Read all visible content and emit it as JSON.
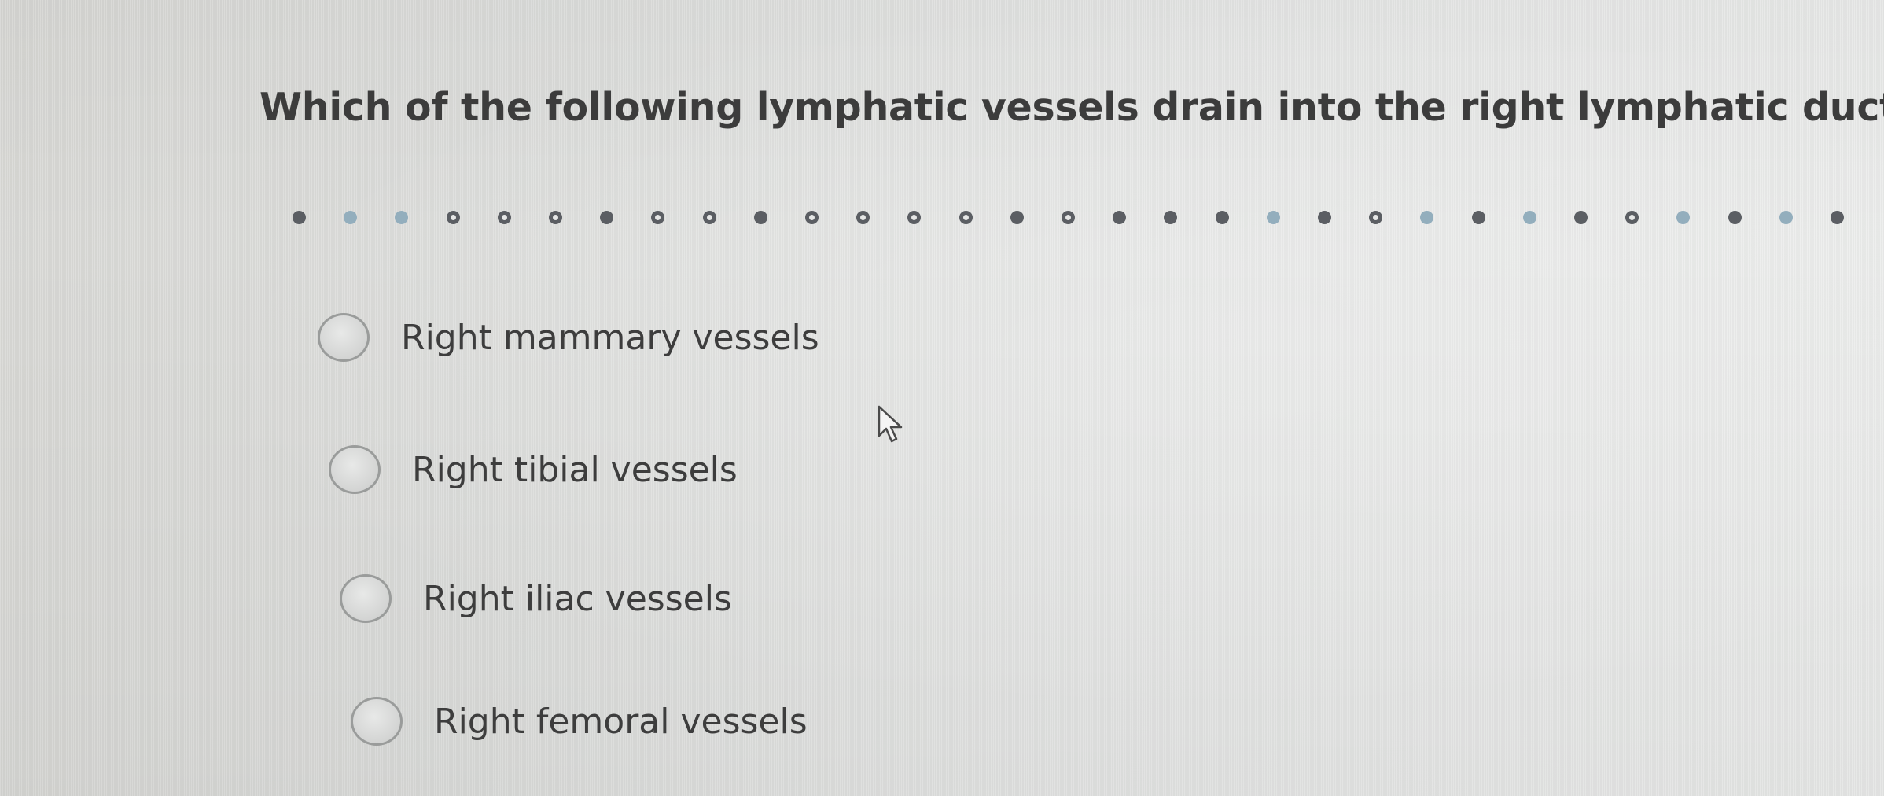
{
  "question": {
    "text": "Which of the following lymphatic vessels drain into the right lymphatic duct?"
  },
  "progress_dots": [
    "filled",
    "light",
    "light",
    "ring",
    "ring",
    "ring",
    "filled",
    "ring",
    "ring",
    "filled",
    "ring",
    "ring",
    "ring",
    "ring",
    "filled",
    "ring",
    "filled",
    "filled",
    "filled",
    "light",
    "filled",
    "ring",
    "light",
    "filled",
    "light",
    "filled",
    "ring",
    "light",
    "filled",
    "light",
    "filled"
  ],
  "options": [
    {
      "label": "Right mammary vessels",
      "selected": false
    },
    {
      "label": "Right tibial vessels",
      "selected": false
    },
    {
      "label": "Right iliac vessels",
      "selected": false
    },
    {
      "label": "Right femoral vessels",
      "selected": false
    }
  ],
  "colors": {
    "text": "#3c3c3c",
    "dot_dark": "#5b5e63",
    "dot_light": "#93aebd",
    "radio_border": "#9a9c9b"
  },
  "icons": {
    "cursor": "mouse-pointer-icon"
  }
}
